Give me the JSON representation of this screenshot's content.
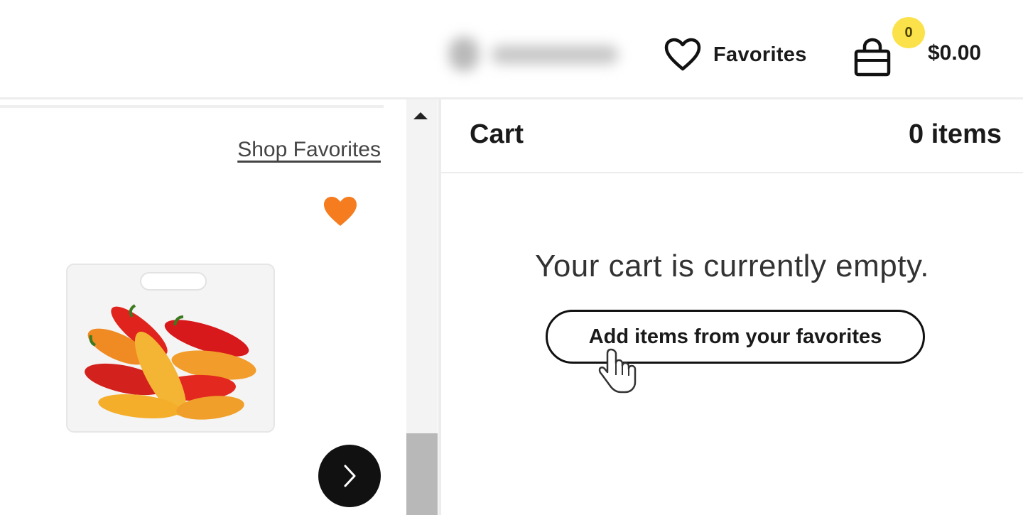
{
  "header": {
    "favorites_label": "Favorites",
    "cart_badge_count": "0",
    "cart_total": "$0.00",
    "icons": {
      "favorites": "heart-outline-icon",
      "cart": "shopping-bag-icon"
    }
  },
  "left_panel": {
    "shop_favorites_label": "Shop Favorites",
    "favorite_icon": "heart-filled-icon",
    "product_image": "mini-sweet-peppers-bag",
    "next_icon": "chevron-right-icon"
  },
  "cart": {
    "title": "Cart",
    "item_count": "0 items",
    "empty_message": "Your cart is currently empty.",
    "add_button_label": "Add items from your favorites"
  },
  "colors": {
    "badge": "#fbe24a",
    "favorite_heart": "#f57c1f",
    "next_button": "#111111",
    "scroll_thumb": "#b8b8b8"
  }
}
